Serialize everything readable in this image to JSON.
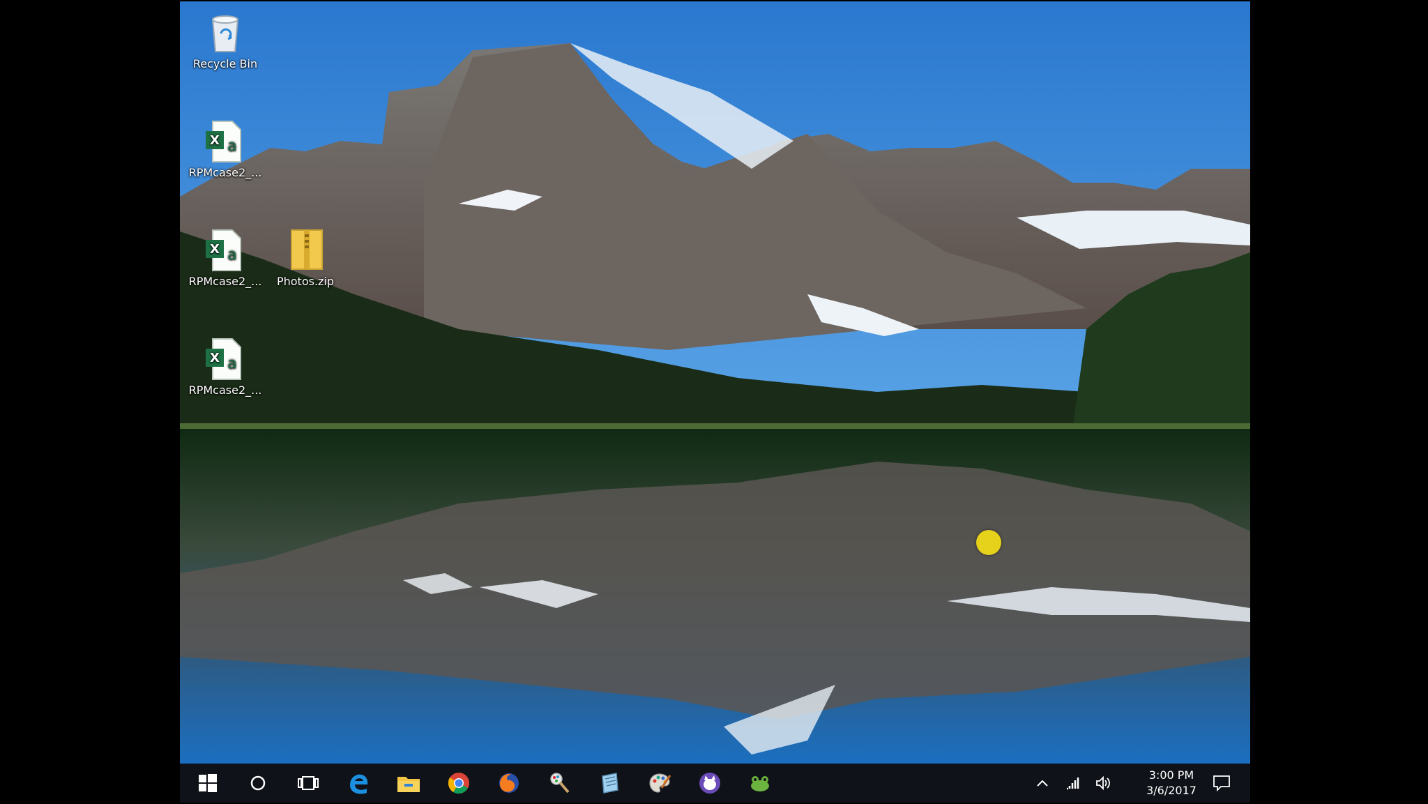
{
  "desktop": {
    "icons": [
      {
        "label": "Recycle Bin",
        "icon": "recycle-bin-icon"
      },
      {
        "label": "RPMcase2_...",
        "icon": "excel-file-icon"
      },
      {
        "label": "RPMcase2_...",
        "icon": "excel-file-icon"
      },
      {
        "label": "Photos.zip",
        "icon": "zip-folder-icon"
      },
      {
        "label": "RPMcase2_...",
        "icon": "excel-file-icon"
      }
    ]
  },
  "taskbar": {
    "pinned": [
      "windows-start-icon",
      "cortana-search-icon",
      "task-view-icon",
      "edge-icon",
      "file-explorer-icon",
      "chrome-icon",
      "firefox-icon",
      "paint-icon",
      "notepad-icon",
      "paint-palette-icon",
      "purple-app-icon",
      "frog-app-icon"
    ],
    "clock": {
      "time": "3:00 PM",
      "date": "3/6/2017"
    }
  },
  "colors": {
    "taskbar": "#0f1218",
    "sky": "#2f7fd0",
    "water": "#1f6eb8"
  }
}
